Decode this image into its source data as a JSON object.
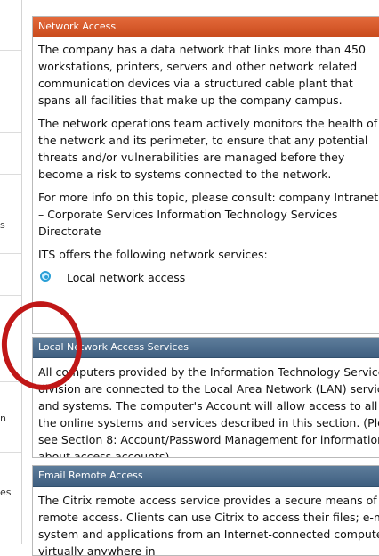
{
  "sidebar": {
    "fragments": [
      "s",
      "n",
      "es"
    ]
  },
  "network_access": {
    "header": "Network Access",
    "paragraphs": [
      "The company has a data network that links more than 450 workstations, printers, servers and other network related communication devices via a structured cable plant that spans all facilities that make up the company campus.",
      "The network operations team actively monitors the health of the network and its perimeter, to ensure that any potential threats and/or vulnerabilities are managed before they become a risk to systems connected to the network.",
      "For more info on this topic, please consult: company Intranet – Corporate Services Information Technology Services Directorate",
      "ITS offers the following network services:"
    ],
    "bullet": "Local network access"
  },
  "lan_services": {
    "header": "Local Network Access Services",
    "text": "All computers provided by the Information Technology Services division are connected to the Local Area Network (LAN) services and systems. The computer's Account will allow access to all of the online systems and services described in this section. (Please see Section 8: Account/Password Management for information about access accounts)."
  },
  "email_remote": {
    "header": "Email Remote Access",
    "text": "The Citrix remote access service provides a secure means of remote access. Clients can use Citrix to access their files; e-mail system and applications from an Internet-connected computer, virtually anywhere in"
  },
  "colors": {
    "orange_header": "#d55a2b",
    "blue_header": "#4a6a8a",
    "annotation": "#c01717"
  }
}
